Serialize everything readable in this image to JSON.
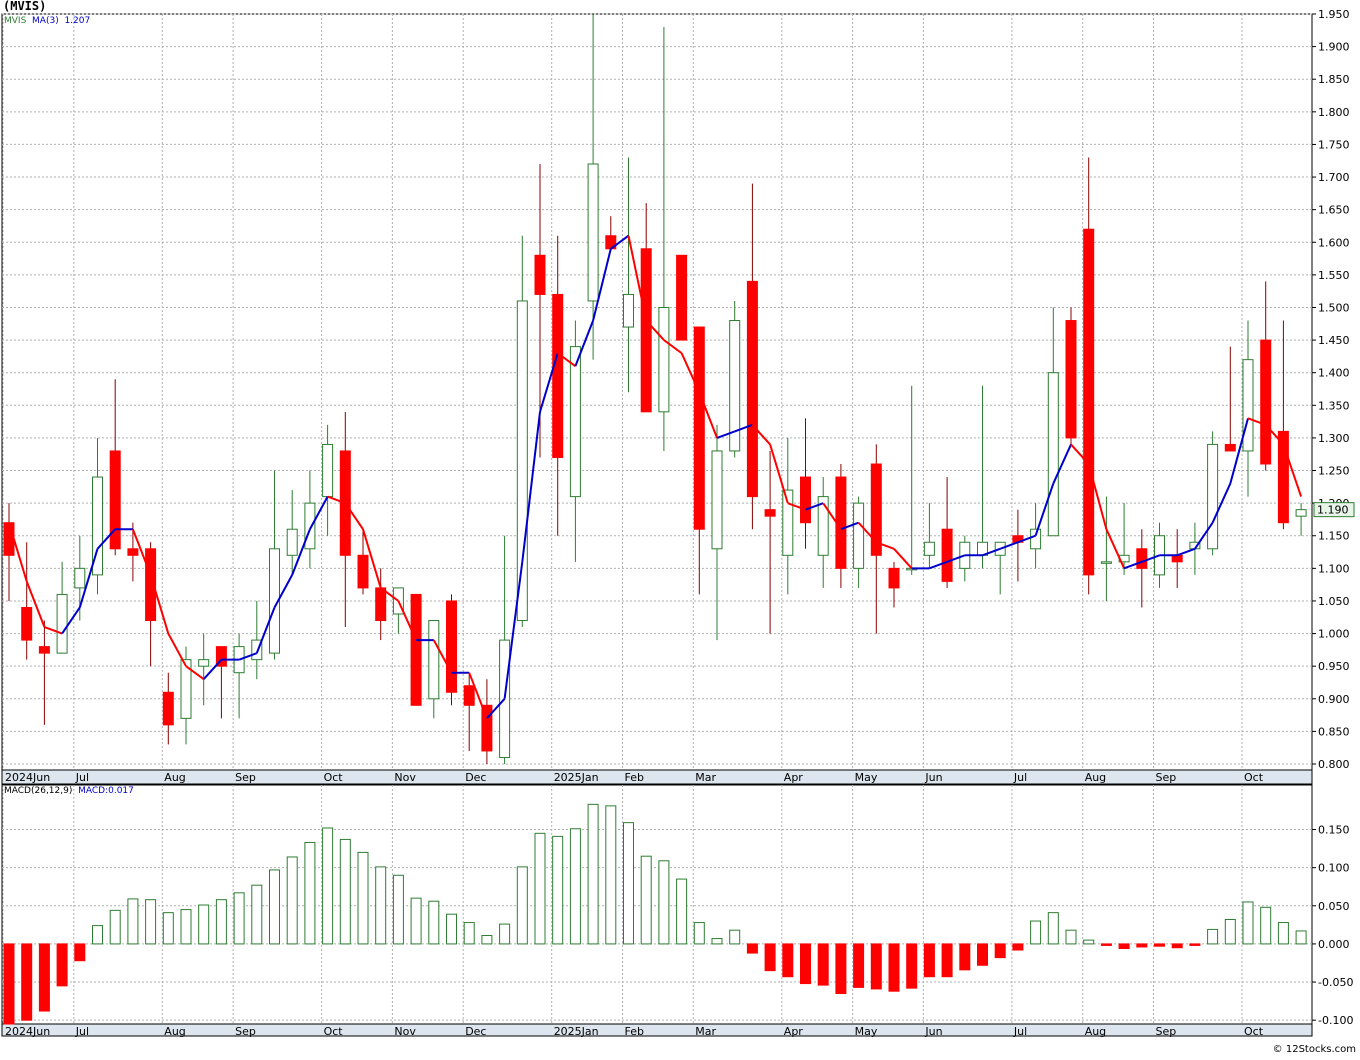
{
  "header": {
    "title": "(MVIS)"
  },
  "legend_top": {
    "symbol": "MVIS",
    "ma_label": "MA(3)",
    "ma_value": "1.207"
  },
  "legend_bottom": {
    "macd_label": "MACD(26,12,9)",
    "macd_value": "MACD:0.017"
  },
  "footer": {
    "text": "© 12Stocks.com"
  },
  "colors": {
    "up": "#2e7d32",
    "down": "#ff0000",
    "ma_up": "#0000cc",
    "ma_down": "#ff0000",
    "grid": "#b0b0b0",
    "axis_strip": "#dde6ee"
  },
  "chart_data": [
    {
      "type": "candlestick",
      "ylim": [
        0.8,
        1.95
      ],
      "grid": true,
      "yticks": [
        "1.950",
        "1.900",
        "1.850",
        "1.800",
        "1.750",
        "1.700",
        "1.650",
        "1.600",
        "1.550",
        "1.500",
        "1.450",
        "1.400",
        "1.350",
        "1.300",
        "1.250",
        "1.200",
        "1.150",
        "1.100",
        "1.050",
        "1.000",
        "0.950",
        "0.900",
        "0.850",
        "0.800"
      ],
      "last_price": "1.190",
      "months": [
        {
          "label": "2024Jun",
          "week": 0
        },
        {
          "label": "Jul",
          "week": 4
        },
        {
          "label": "Aug",
          "week": 9
        },
        {
          "label": "Sep",
          "week": 13
        },
        {
          "label": "Oct",
          "week": 18
        },
        {
          "label": "Nov",
          "week": 22
        },
        {
          "label": "Dec",
          "week": 26
        },
        {
          "label": "2025Jan",
          "week": 31
        },
        {
          "label": "Feb",
          "week": 35
        },
        {
          "label": "Mar",
          "week": 39
        },
        {
          "label": "Apr",
          "week": 44
        },
        {
          "label": "May",
          "week": 48
        },
        {
          "label": "Jun",
          "week": 52
        },
        {
          "label": "Jul",
          "week": 57
        },
        {
          "label": "Aug",
          "week": 61
        },
        {
          "label": "Sep",
          "week": 65
        },
        {
          "label": "Oct",
          "week": 70
        }
      ],
      "candles": [
        {
          "o": 1.17,
          "h": 1.2,
          "l": 1.05,
          "c": 1.12
        },
        {
          "o": 1.04,
          "h": 1.14,
          "l": 0.96,
          "c": 0.99
        },
        {
          "o": 0.98,
          "h": 1.02,
          "l": 0.86,
          "c": 0.97
        },
        {
          "o": 0.97,
          "h": 1.11,
          "l": 0.97,
          "c": 1.06
        },
        {
          "o": 1.07,
          "h": 1.15,
          "l": 1.02,
          "c": 1.1
        },
        {
          "o": 1.09,
          "h": 1.3,
          "l": 1.06,
          "c": 1.24
        },
        {
          "o": 1.28,
          "h": 1.39,
          "l": 1.12,
          "c": 1.13
        },
        {
          "o": 1.13,
          "h": 1.17,
          "l": 1.08,
          "c": 1.12
        },
        {
          "o": 1.13,
          "h": 1.14,
          "l": 0.95,
          "c": 1.02
        },
        {
          "o": 0.91,
          "h": 0.94,
          "l": 0.83,
          "c": 0.86
        },
        {
          "o": 0.87,
          "h": 0.98,
          "l": 0.83,
          "c": 0.96
        },
        {
          "o": 0.95,
          "h": 1.0,
          "l": 0.89,
          "c": 0.96
        },
        {
          "o": 0.98,
          "h": 0.98,
          "l": 0.87,
          "c": 0.95
        },
        {
          "o": 0.94,
          "h": 1.0,
          "l": 0.87,
          "c": 0.98
        },
        {
          "o": 0.96,
          "h": 1.05,
          "l": 0.93,
          "c": 0.99
        },
        {
          "o": 0.97,
          "h": 1.25,
          "l": 0.96,
          "c": 1.13
        },
        {
          "o": 1.12,
          "h": 1.22,
          "l": 1.09,
          "c": 1.16
        },
        {
          "o": 1.13,
          "h": 1.25,
          "l": 1.1,
          "c": 1.2
        },
        {
          "o": 1.21,
          "h": 1.32,
          "l": 1.15,
          "c": 1.29
        },
        {
          "o": 1.28,
          "h": 1.34,
          "l": 1.01,
          "c": 1.12
        },
        {
          "o": 1.12,
          "h": 1.16,
          "l": 1.06,
          "c": 1.07
        },
        {
          "o": 1.07,
          "h": 1.1,
          "l": 0.99,
          "c": 1.02
        },
        {
          "o": 1.03,
          "h": 1.07,
          "l": 1.0,
          "c": 1.07
        },
        {
          "o": 1.06,
          "h": 1.06,
          "l": 0.89,
          "c": 0.89
        },
        {
          "o": 0.9,
          "h": 1.02,
          "l": 0.87,
          "c": 1.02
        },
        {
          "o": 1.05,
          "h": 1.06,
          "l": 0.89,
          "c": 0.91
        },
        {
          "o": 0.92,
          "h": 0.94,
          "l": 0.82,
          "c": 0.89
        },
        {
          "o": 0.89,
          "h": 0.93,
          "l": 0.8,
          "c": 0.82
        },
        {
          "o": 0.81,
          "h": 1.15,
          "l": 0.8,
          "c": 0.99
        },
        {
          "o": 1.02,
          "h": 1.61,
          "l": 1.01,
          "c": 1.51
        },
        {
          "o": 1.58,
          "h": 1.72,
          "l": 1.27,
          "c": 1.52
        },
        {
          "o": 1.52,
          "h": 1.61,
          "l": 1.15,
          "c": 1.27
        },
        {
          "o": 1.21,
          "h": 1.48,
          "l": 1.11,
          "c": 1.44
        },
        {
          "o": 1.51,
          "h": 1.95,
          "l": 1.42,
          "c": 1.72
        },
        {
          "o": 1.61,
          "h": 1.64,
          "l": 1.59,
          "c": 1.59
        },
        {
          "o": 1.47,
          "h": 1.73,
          "l": 1.37,
          "c": 1.52
        },
        {
          "o": 1.59,
          "h": 1.66,
          "l": 1.34,
          "c": 1.34
        },
        {
          "o": 1.34,
          "h": 1.93,
          "l": 1.28,
          "c": 1.5
        },
        {
          "o": 1.58,
          "h": 1.58,
          "l": 1.45,
          "c": 1.45
        },
        {
          "o": 1.47,
          "h": 1.47,
          "l": 1.06,
          "c": 1.16
        },
        {
          "o": 1.13,
          "h": 1.32,
          "l": 0.99,
          "c": 1.28
        },
        {
          "o": 1.28,
          "h": 1.51,
          "l": 1.27,
          "c": 1.48
        },
        {
          "o": 1.54,
          "h": 1.69,
          "l": 1.16,
          "c": 1.21
        },
        {
          "o": 1.19,
          "h": 1.28,
          "l": 1.0,
          "c": 1.18
        },
        {
          "o": 1.12,
          "h": 1.3,
          "l": 1.06,
          "c": 1.22
        },
        {
          "o": 1.24,
          "h": 1.33,
          "l": 1.13,
          "c": 1.17
        },
        {
          "o": 1.12,
          "h": 1.24,
          "l": 1.07,
          "c": 1.21
        },
        {
          "o": 1.24,
          "h": 1.26,
          "l": 1.07,
          "c": 1.1
        },
        {
          "o": 1.1,
          "h": 1.21,
          "l": 1.07,
          "c": 1.2
        },
        {
          "o": 1.26,
          "h": 1.29,
          "l": 1.0,
          "c": 1.12
        },
        {
          "o": 1.1,
          "h": 1.11,
          "l": 1.04,
          "c": 1.07
        },
        {
          "o": 1.1,
          "h": 1.38,
          "l": 1.09,
          "c": 1.1
        },
        {
          "o": 1.12,
          "h": 1.2,
          "l": 1.1,
          "c": 1.14
        },
        {
          "o": 1.16,
          "h": 1.24,
          "l": 1.07,
          "c": 1.08
        },
        {
          "o": 1.1,
          "h": 1.15,
          "l": 1.08,
          "c": 1.14
        },
        {
          "o": 1.12,
          "h": 1.38,
          "l": 1.1,
          "c": 1.14
        },
        {
          "o": 1.12,
          "h": 1.14,
          "l": 1.06,
          "c": 1.14
        },
        {
          "o": 1.15,
          "h": 1.19,
          "l": 1.08,
          "c": 1.14
        },
        {
          "o": 1.13,
          "h": 1.2,
          "l": 1.1,
          "c": 1.16
        },
        {
          "o": 1.15,
          "h": 1.5,
          "l": 1.15,
          "c": 1.4
        },
        {
          "o": 1.48,
          "h": 1.5,
          "l": 1.29,
          "c": 1.3
        },
        {
          "o": 1.62,
          "h": 1.73,
          "l": 1.06,
          "c": 1.09
        },
        {
          "o": 1.11,
          "h": 1.21,
          "l": 1.05,
          "c": 1.11
        },
        {
          "o": 1.11,
          "h": 1.2,
          "l": 1.09,
          "c": 1.12
        },
        {
          "o": 1.13,
          "h": 1.16,
          "l": 1.04,
          "c": 1.1
        },
        {
          "o": 1.09,
          "h": 1.17,
          "l": 1.07,
          "c": 1.15
        },
        {
          "o": 1.12,
          "h": 1.16,
          "l": 1.07,
          "c": 1.11
        },
        {
          "o": 1.13,
          "h": 1.17,
          "l": 1.09,
          "c": 1.14
        },
        {
          "o": 1.13,
          "h": 1.31,
          "l": 1.12,
          "c": 1.29
        },
        {
          "o": 1.29,
          "h": 1.44,
          "l": 1.28,
          "c": 1.28
        },
        {
          "o": 1.28,
          "h": 1.48,
          "l": 1.21,
          "c": 1.42
        },
        {
          "o": 1.45,
          "h": 1.54,
          "l": 1.25,
          "c": 1.26
        },
        {
          "o": 1.31,
          "h": 1.48,
          "l": 1.16,
          "c": 1.17
        },
        {
          "o": 1.18,
          "h": 1.2,
          "l": 1.15,
          "c": 1.19
        }
      ],
      "ma3": [
        1.17,
        1.08,
        1.01,
        1.0,
        1.04,
        1.13,
        1.16,
        1.16,
        1.09,
        1.0,
        0.95,
        0.93,
        0.96,
        0.96,
        0.97,
        1.04,
        1.09,
        1.16,
        1.21,
        1.2,
        1.16,
        1.07,
        1.05,
        0.99,
        0.99,
        0.94,
        0.94,
        0.87,
        0.9,
        1.11,
        1.34,
        1.43,
        1.41,
        1.48,
        1.59,
        1.61,
        1.48,
        1.45,
        1.43,
        1.37,
        1.3,
        1.31,
        1.32,
        1.29,
        1.2,
        1.19,
        1.2,
        1.16,
        1.17,
        1.14,
        1.13,
        1.1,
        1.1,
        1.11,
        1.12,
        1.12,
        1.13,
        1.14,
        1.15,
        1.23,
        1.29,
        1.26,
        1.16,
        1.1,
        1.11,
        1.12,
        1.12,
        1.13,
        1.17,
        1.23,
        1.33,
        1.32,
        1.29,
        1.21
      ]
    },
    {
      "type": "bar",
      "ylim": [
        -0.105,
        0.19
      ],
      "grid": true,
      "yticks": [
        "0.150",
        "0.100",
        "0.050",
        "0.000",
        "-0.050",
        "-0.100"
      ],
      "values": [
        -0.105,
        -0.1,
        -0.088,
        -0.055,
        -0.022,
        0.024,
        0.044,
        0.059,
        0.058,
        0.041,
        0.045,
        0.051,
        0.058,
        0.067,
        0.077,
        0.097,
        0.114,
        0.133,
        0.152,
        0.137,
        0.12,
        0.101,
        0.09,
        0.06,
        0.056,
        0.039,
        0.028,
        0.011,
        0.026,
        0.101,
        0.145,
        0.141,
        0.151,
        0.183,
        0.181,
        0.159,
        0.115,
        0.109,
        0.085,
        0.028,
        0.007,
        0.018,
        -0.012,
        -0.035,
        -0.043,
        -0.052,
        -0.054,
        -0.065,
        -0.057,
        -0.059,
        -0.062,
        -0.058,
        -0.043,
        -0.043,
        -0.034,
        -0.028,
        -0.018,
        -0.008,
        0.03,
        0.041,
        0.018,
        0.005,
        -0.002,
        -0.006,
        -0.004,
        -0.003,
        -0.005,
        -0.002,
        0.019,
        0.032,
        0.055,
        0.048,
        0.028,
        0.017
      ]
    }
  ]
}
